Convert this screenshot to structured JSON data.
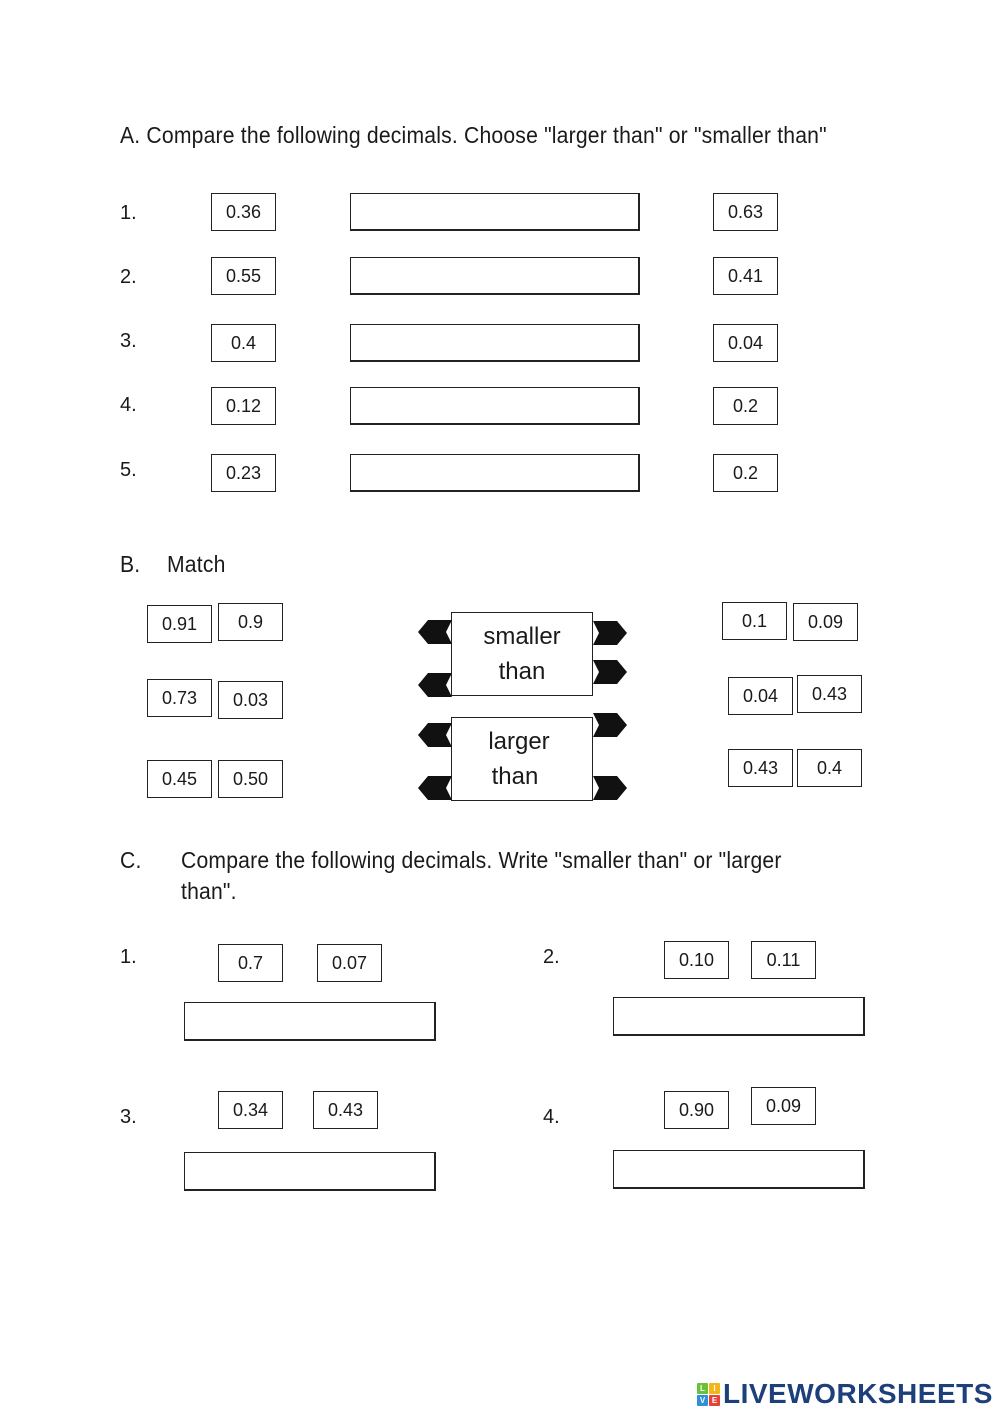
{
  "section_a": {
    "heading": "A. Compare the following decimals. Choose \"larger than\" or \"smaller than\"",
    "rows": [
      {
        "label": "1.",
        "left": "0.36",
        "right": "0.63",
        "answer": ""
      },
      {
        "label": "2.",
        "left": "0.55",
        "right": "0.41",
        "answer": ""
      },
      {
        "label": "3.",
        "left": "0.4",
        "right": "0.04",
        "answer": ""
      },
      {
        "label": "4.",
        "left": "0.12",
        "right": "0.2",
        "answer": ""
      },
      {
        "label": "5.",
        "left": "0.23",
        "right": "0.2",
        "answer": ""
      }
    ]
  },
  "section_b": {
    "label": "B.",
    "title": "Match",
    "left_pairs": [
      [
        "0.91",
        "0.9"
      ],
      [
        "0.73",
        "0.03"
      ],
      [
        "0.45",
        "0.50"
      ]
    ],
    "right_pairs": [
      [
        "0.1",
        "0.09"
      ],
      [
        "0.04",
        "0.43"
      ],
      [
        "0.43",
        "0.4"
      ]
    ],
    "targets": [
      {
        "line1": "smaller",
        "line2": "than"
      },
      {
        "line1": "larger",
        "line2": "than"
      }
    ]
  },
  "section_c": {
    "label": "C.",
    "heading_line1": "Compare the following decimals.  Write \"smaller than\" or \"larger",
    "heading_line2": "than\".",
    "items": [
      {
        "label": "1.",
        "a": "0.7",
        "b": "0.07",
        "answer": ""
      },
      {
        "label": "2.",
        "a": "0.10",
        "b": "0.11",
        "answer": ""
      },
      {
        "label": "3.",
        "a": "0.34",
        "b": "0.43",
        "answer": ""
      },
      {
        "label": "4.",
        "a": "0.90",
        "b": "0.09",
        "answer": ""
      }
    ]
  },
  "footer": {
    "logo_text": "LIVEWORKSHEETS",
    "logo_tiles": [
      {
        "letter": "L",
        "color": "#6cbf3a"
      },
      {
        "letter": "I",
        "color": "#f2b619"
      },
      {
        "letter": "V",
        "color": "#2f8fd8"
      },
      {
        "letter": "E",
        "color": "#e2443a"
      }
    ]
  }
}
